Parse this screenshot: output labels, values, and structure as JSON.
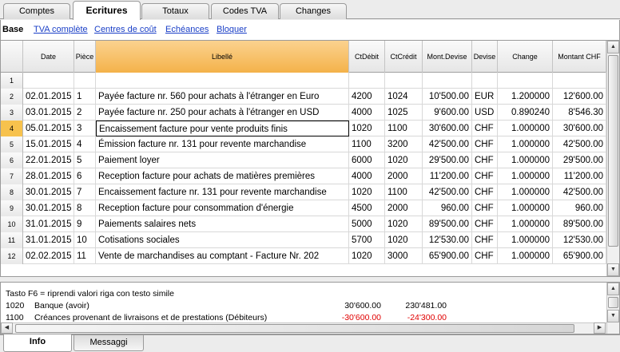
{
  "tabs": [
    {
      "label": "Comptes",
      "active": false
    },
    {
      "label": "Ecritures",
      "active": true
    },
    {
      "label": "Totaux",
      "active": false
    },
    {
      "label": "Codes TVA",
      "active": false
    },
    {
      "label": "Changes",
      "active": false
    }
  ],
  "views": {
    "current": "Base",
    "links": [
      "TVA complète",
      "Centres de coût",
      "Echéances",
      "Bloquer"
    ]
  },
  "table": {
    "columns": [
      "Date",
      "Pièce",
      "Libellé",
      "CtDébit",
      "CtCrédit",
      "Mont.Devise",
      "Devise",
      "Change",
      "Montant CHF"
    ],
    "selected_row": "4",
    "rows": [
      {
        "n": "1",
        "cells": [
          "",
          "",
          "",
          "",
          "",
          "",
          "",
          "",
          ""
        ]
      },
      {
        "n": "2",
        "cells": [
          "02.01.2015",
          "1",
          "Payée facture nr. 560 pour achats à l'étranger en Euro",
          "4200",
          "1024",
          "10'500.00",
          "EUR",
          "1.200000",
          "12'600.00"
        ]
      },
      {
        "n": "3",
        "cells": [
          "03.01.2015",
          "2",
          "Payée facture nr. 250 pour achats à l'étranger en USD",
          "4000",
          "1025",
          "9'600.00",
          "USD",
          "0.890240",
          "8'546.30"
        ]
      },
      {
        "n": "4",
        "cells": [
          "05.01.2015",
          "3",
          "Encaissement facture pour vente produits finis",
          "1020",
          "1100",
          "30'600.00",
          "CHF",
          "1.000000",
          "30'600.00"
        ]
      },
      {
        "n": "5",
        "cells": [
          "15.01.2015",
          "4",
          "Émission facture nr. 131 pour revente marchandise",
          "1100",
          "3200",
          "42'500.00",
          "CHF",
          "1.000000",
          "42'500.00"
        ]
      },
      {
        "n": "6",
        "cells": [
          "22.01.2015",
          "5",
          "Paiement loyer",
          "6000",
          "1020",
          "29'500.00",
          "CHF",
          "1.000000",
          "29'500.00"
        ]
      },
      {
        "n": "7",
        "cells": [
          "28.01.2015",
          "6",
          "Reception facture pour achats de matières premières",
          "4000",
          "2000",
          "11'200.00",
          "CHF",
          "1.000000",
          "11'200.00"
        ]
      },
      {
        "n": "8",
        "cells": [
          "30.01.2015",
          "7",
          "Encaissement facture nr. 131 pour revente marchandise",
          "1020",
          "1100",
          "42'500.00",
          "CHF",
          "1.000000",
          "42'500.00"
        ]
      },
      {
        "n": "9",
        "cells": [
          "30.01.2015",
          "8",
          "Reception facture pour consommation d'énergie",
          "4500",
          "2000",
          "960.00",
          "CHF",
          "1.000000",
          "960.00"
        ]
      },
      {
        "n": "10",
        "cells": [
          "31.01.2015",
          "9",
          "Paiements salaires nets",
          "5000",
          "1020",
          "89'500.00",
          "CHF",
          "1.000000",
          "89'500.00"
        ]
      },
      {
        "n": "11",
        "cells": [
          "31.01.2015",
          "10",
          "Cotisations sociales",
          "5700",
          "1020",
          "12'530.00",
          "CHF",
          "1.000000",
          "12'530.00"
        ]
      },
      {
        "n": "12",
        "cells": [
          "02.02.2015",
          "11",
          "Vente de marchandises au comptant - Facture Nr. 202",
          "1020",
          "3000",
          "65'900.00",
          "CHF",
          "1.000000",
          "65'900.00"
        ]
      }
    ]
  },
  "info": {
    "hint": "Tasto F6 = riprendi valori riga con testo simile",
    "accounts": [
      {
        "code": "1020",
        "desc": "Banque (avoir)",
        "amount": "30'600.00",
        "balance": "230'481.00",
        "negative": false
      },
      {
        "code": "1100",
        "desc": "Créances provenant de livraisons et de prestations (Débiteurs)",
        "amount": "-30'600.00",
        "balance": "-24'300.00",
        "negative": true
      }
    ]
  },
  "bottom_tabs": [
    {
      "label": "Info",
      "active": true
    },
    {
      "label": "Messaggi",
      "active": false
    }
  ]
}
